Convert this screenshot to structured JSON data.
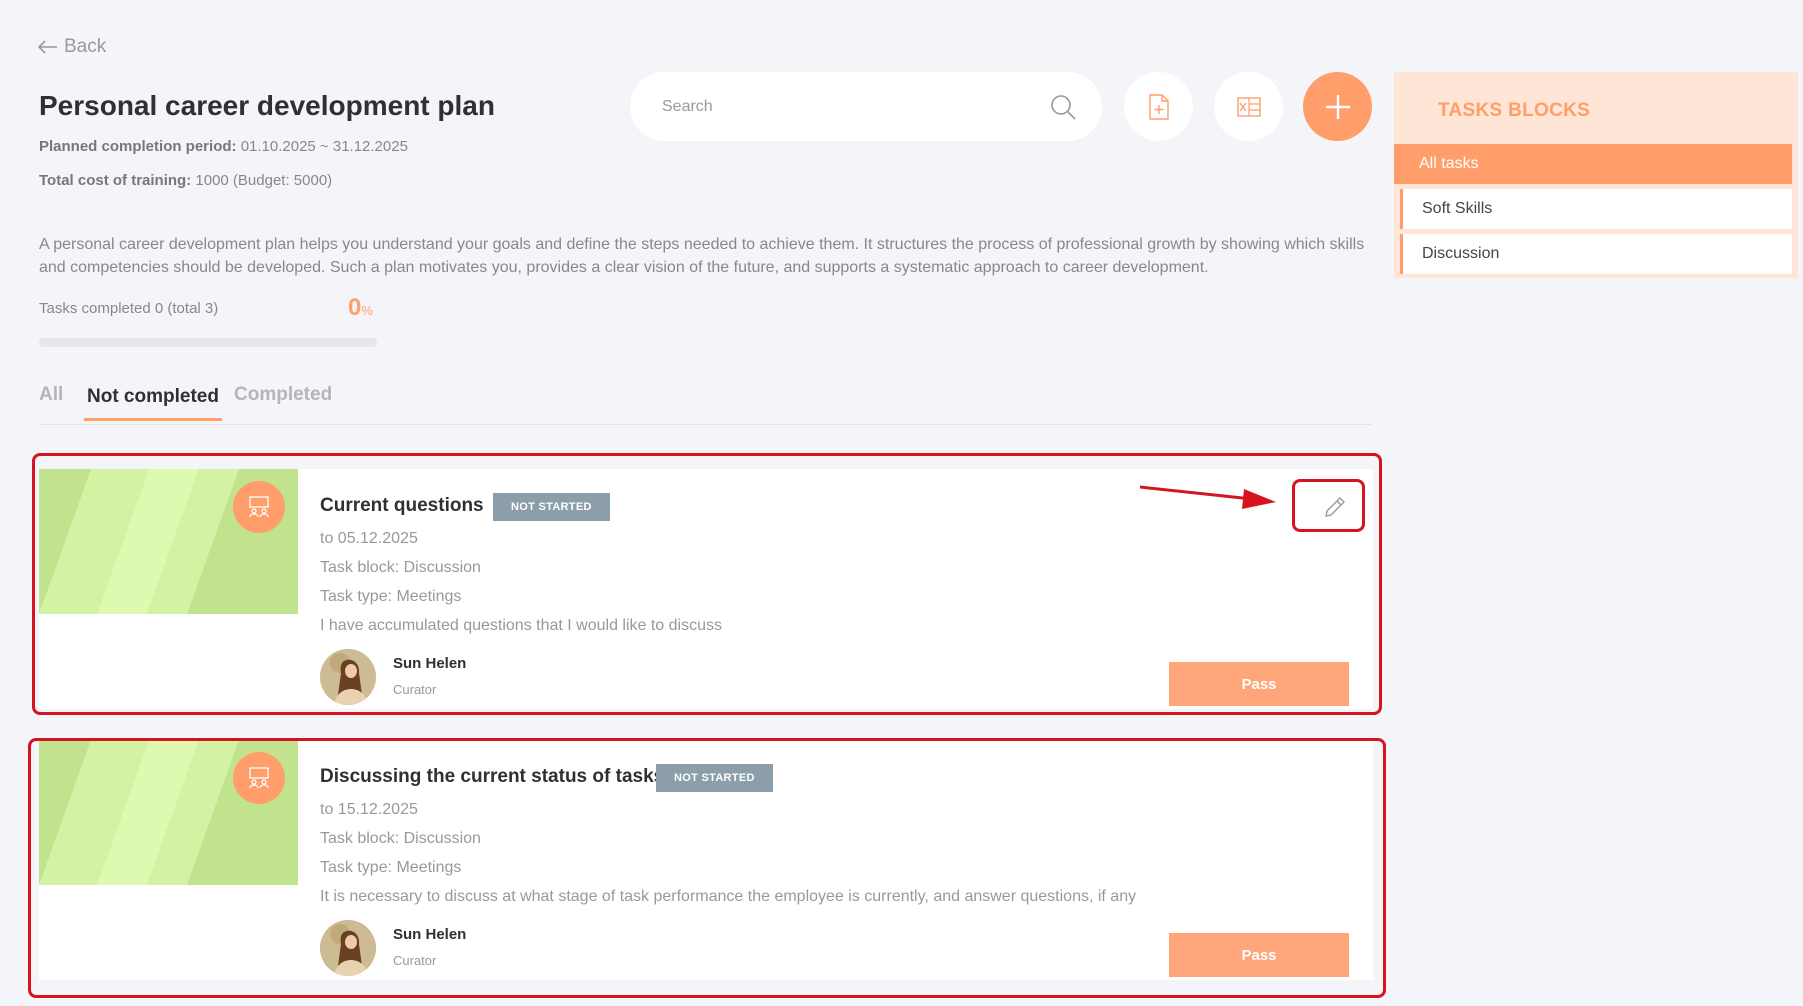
{
  "header": {
    "back_label": "Back",
    "title": "Personal career development plan",
    "period_label": "Planned completion period:",
    "period_value": "01.10.2025 ~ 31.12.2025",
    "cost_label": "Total cost of training:",
    "cost_value": "1000 (Budget: 5000)"
  },
  "search": {
    "placeholder": "Search"
  },
  "description": "A personal career development plan helps you understand your goals and define the steps needed to achieve them. It structures the process of professional growth by showing which skills and competencies should be developed. Such a plan motivates you, provides a clear vision of the future, and supports a systematic approach to career development.",
  "progress": {
    "label": "Tasks completed 0 (total 3)",
    "percent_value": "0",
    "percent_unit": "%",
    "fraction": 0
  },
  "tabs": [
    {
      "label": "All"
    },
    {
      "label": "Not completed"
    },
    {
      "label": "Completed"
    }
  ],
  "tasks": [
    {
      "title": "Current questions",
      "status": "NOT STARTED",
      "due": "to 05.12.2025",
      "block": "Task block: Discussion",
      "type": "Task type: Meetings",
      "description": "I have accumulated questions that I would like to discuss",
      "curator_name": "Sun Helen",
      "curator_role": "Curator",
      "action_label": "Pass"
    },
    {
      "title": "Discussing the current status of tasks",
      "status": "NOT STARTED",
      "due": "to 15.12.2025",
      "block": "Task block: Discussion",
      "type": "Task type: Meetings",
      "description": "It is necessary to discuss at what stage of task performance the employee is currently, and answer questions, if any",
      "curator_name": "Sun Helen",
      "curator_role": "Curator",
      "action_label": "Pass"
    }
  ],
  "sidebar": {
    "title": "TASKS BLOCKS",
    "items": [
      {
        "label": "All tasks"
      },
      {
        "label": "Soft Skills"
      },
      {
        "label": "Discussion"
      }
    ]
  },
  "colors": {
    "accent": "#ff9e6b",
    "badge": "#8c9eaa",
    "highlight": "#d6141f",
    "thumbnail": "#c2e38e"
  },
  "icons": {
    "back": "arrow-left-icon",
    "search": "search-icon",
    "add_doc": "add-document-icon",
    "excel": "excel-icon",
    "add": "plus-icon",
    "task_type": "meeting-icon",
    "edit": "pencil-icon"
  }
}
